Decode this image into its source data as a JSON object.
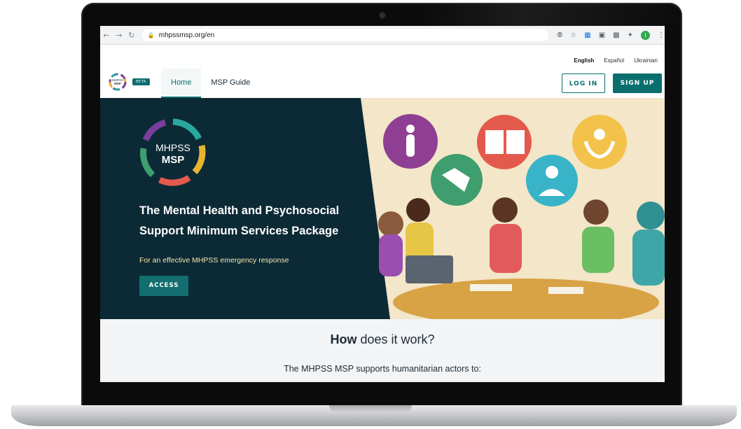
{
  "browser": {
    "back_icon": "arrow-left-icon",
    "forward_icon": "arrow-right-icon",
    "reload_icon": "reload-icon",
    "url": "mhpssmsp.org/en",
    "profile_initial": "I"
  },
  "header": {
    "languages": [
      "English",
      "Español",
      "Ukrainian"
    ],
    "active_language": "English",
    "beta_badge": "BETA",
    "logo_text_top": "MHPSS",
    "logo_text_bottom": "MSP",
    "nav": [
      "Home",
      "MSP Guide"
    ],
    "login_label": "LOG IN",
    "signup_label": "SIGN UP"
  },
  "hero": {
    "logo_top": "MHPSS",
    "logo_bottom": "MSP",
    "title_line1": "The Mental Health and Psychosocial",
    "title_line2": "Support Minimum Services Package",
    "subtitle": "For an effective MHPSS emergency response",
    "cta_label": "ACCESS"
  },
  "how": {
    "title_bold": "How",
    "title_rest": " does it work?",
    "intro": "The MHPSS MSP supports humanitarian actors to:"
  },
  "colors": {
    "brand_teal": "#0b6e6e",
    "hero_bg": "#0c2a36",
    "hero_sub": "#f4e7a8",
    "illustration_bg": "#f3e6c9"
  }
}
